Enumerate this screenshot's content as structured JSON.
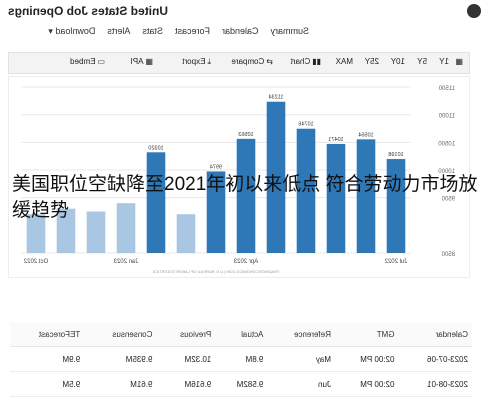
{
  "header": {
    "title": "United States Job Openings",
    "nav": [
      "Summary",
      "Calendar",
      "Forecast",
      "Stats",
      "Alerts",
      "Download"
    ]
  },
  "toolbar": {
    "ranges": [
      "1Y",
      "5Y",
      "10Y",
      "25Y",
      "MAX"
    ],
    "chart_label": "Chart",
    "compare_label": "Compare",
    "export_label": "Export",
    "api_label": "API",
    "embed_label": "Embed"
  },
  "chart_data": {
    "type": "bar",
    "categories": [
      "Jul 2022",
      "",
      "",
      "",
      "",
      "Apr 2023",
      "",
      "",
      "",
      "Jan 2023",
      "",
      "",
      "Oct 2022"
    ],
    "values": [
      10198,
      10554,
      10471,
      10746,
      11234,
      10563,
      9974,
      9200,
      10320,
      9400,
      9250,
      9300,
      9200
    ],
    "value_labels": [
      "10198",
      "10554",
      "10471",
      "10746",
      "11234",
      "10563",
      "9974",
      "",
      "10320",
      "",
      "",
      "",
      ""
    ],
    "ylim": [
      8500,
      11500
    ],
    "yticks": [
      "11500",
      "11000",
      "10500",
      "10000",
      "9500",
      "8500"
    ],
    "x_tick_labels": [
      "Jul 2022",
      "Apr 2023",
      "Jan 2023",
      "Oct 2022"
    ],
    "source": "TRADINGECONOMICS.COM | U.S. BUREAU OF LABOR STATISTICS",
    "highlight_color": "#2e78b8",
    "light_color": "#a9c6e2"
  },
  "overlay_text": "美国职位空缺降至2021年初以来低点 符合劳动力市场放缓趋势",
  "table": {
    "headers": [
      "Calendar",
      "GMT",
      "Reference",
      "Actual",
      "Previous",
      "Consensus",
      "TEForecast"
    ],
    "rows": [
      [
        "2023-07-06",
        "02:00 PM",
        "May",
        "9.8M",
        "10.32M",
        "9.935M",
        "9.9M"
      ],
      [
        "2023-08-01",
        "02:00 PM",
        "Jun",
        "9.582M",
        "9.616M",
        "9.61M",
        "9.5M"
      ]
    ]
  }
}
